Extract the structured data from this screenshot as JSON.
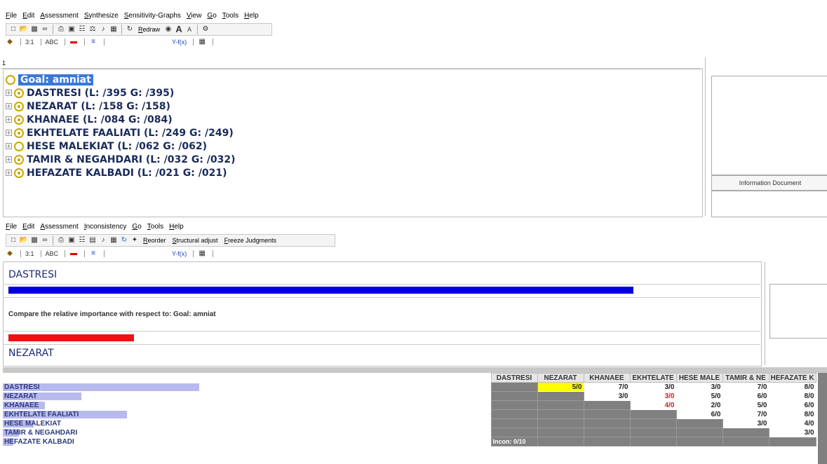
{
  "top_window": {
    "menu": [
      "File",
      "Edit",
      "Assessment",
      "Synthesize",
      "Sensitivity-Graphs",
      "View",
      "Go",
      "Tools",
      "Help"
    ],
    "toolbar_redraw_label": "Redraw",
    "toolbar2_items": [
      "3:1",
      "ABC",
      "Y-f(x)"
    ],
    "tree_header": "1",
    "goal_label": "Goal: amniat",
    "nodes": [
      {
        "label": "DASTRESI (L: /395 G: /395)",
        "dot": true
      },
      {
        "label": "NEZARAT (L: /158 G: /158)",
        "dot": true
      },
      {
        "label": "KHANAEE (L: /084 G: /084)",
        "dot": true
      },
      {
        "label": "EKHTELATE FAALIATI (L: /249 G: /249)",
        "dot": true
      },
      {
        "label": "HESE MALEKIAT (L: /062 G: /062)",
        "dot": false
      },
      {
        "label": "TAMIR & NEGAHDARI (L: /032 G: /032)",
        "dot": true
      },
      {
        "label": "HEFAZATE KALBADI (L: /021 G: /021)",
        "dot": true
      }
    ],
    "info_document_label": "Information Document"
  },
  "bottom_window": {
    "menu": [
      "File",
      "Edit",
      "Assessment",
      "Inconsistency",
      "Go",
      "Tools",
      "Help"
    ],
    "toolbar_labels": {
      "reorder": "Reorder",
      "structural_adjust": "Structural adjust",
      "freeze": "Freeze Judgments"
    },
    "toolbar2_items": [
      "3:1",
      "ABC",
      "Y-f(x)"
    ],
    "element_a": "DASTRESI",
    "element_b": "NEZARAT",
    "compare_text": "Compare the relative importance  with respect to: Goal: amniat",
    "bar_a_color": "#0000dd",
    "bar_b_color": "#ee1111",
    "bar_a_fraction": 0.833,
    "bar_b_fraction": 0.167
  },
  "matrix": {
    "columns": [
      "DASTRESI",
      "NEZARAT",
      "KHANAEE",
      "EKHTELATE",
      "HESE MALE",
      "TAMIR & NE",
      "HEFAZATE K"
    ],
    "rows": [
      {
        "label": "DASTRESI",
        "weight": 0.395,
        "cells": [
          "G",
          "Y:5/0",
          "7/0",
          "3/0",
          "3/0",
          "7/0",
          "8/0"
        ]
      },
      {
        "label": "NEZARAT",
        "weight": 0.158,
        "cells": [
          "G",
          "G",
          "3/0",
          "R:3/0",
          "5/0",
          "6/0",
          "8/0"
        ]
      },
      {
        "label": "KHANAEE",
        "weight": 0.084,
        "cells": [
          "G",
          "G",
          "G",
          "R:4/0",
          "2/0",
          "5/0",
          "6/0"
        ]
      },
      {
        "label": "EKHTELATE FAALIATI",
        "weight": 0.249,
        "cells": [
          "G",
          "G",
          "G",
          "G",
          "6/0",
          "7/0",
          "8/0"
        ]
      },
      {
        "label": "HESE MALEKIAT",
        "weight": 0.062,
        "cells": [
          "G",
          "G",
          "G",
          "G",
          "G",
          "3/0",
          "4/0"
        ]
      },
      {
        "label": "TAMIR & NEGAHDARI",
        "weight": 0.032,
        "cells": [
          "G",
          "G",
          "G",
          "G",
          "G",
          "G",
          "3/0"
        ]
      },
      {
        "label": "HEFAZATE KALBADI",
        "weight": 0.021,
        "cells": [
          "G",
          "G",
          "G",
          "G",
          "G",
          "G",
          "G"
        ]
      }
    ],
    "incon_label": "Incon: 0/10"
  }
}
